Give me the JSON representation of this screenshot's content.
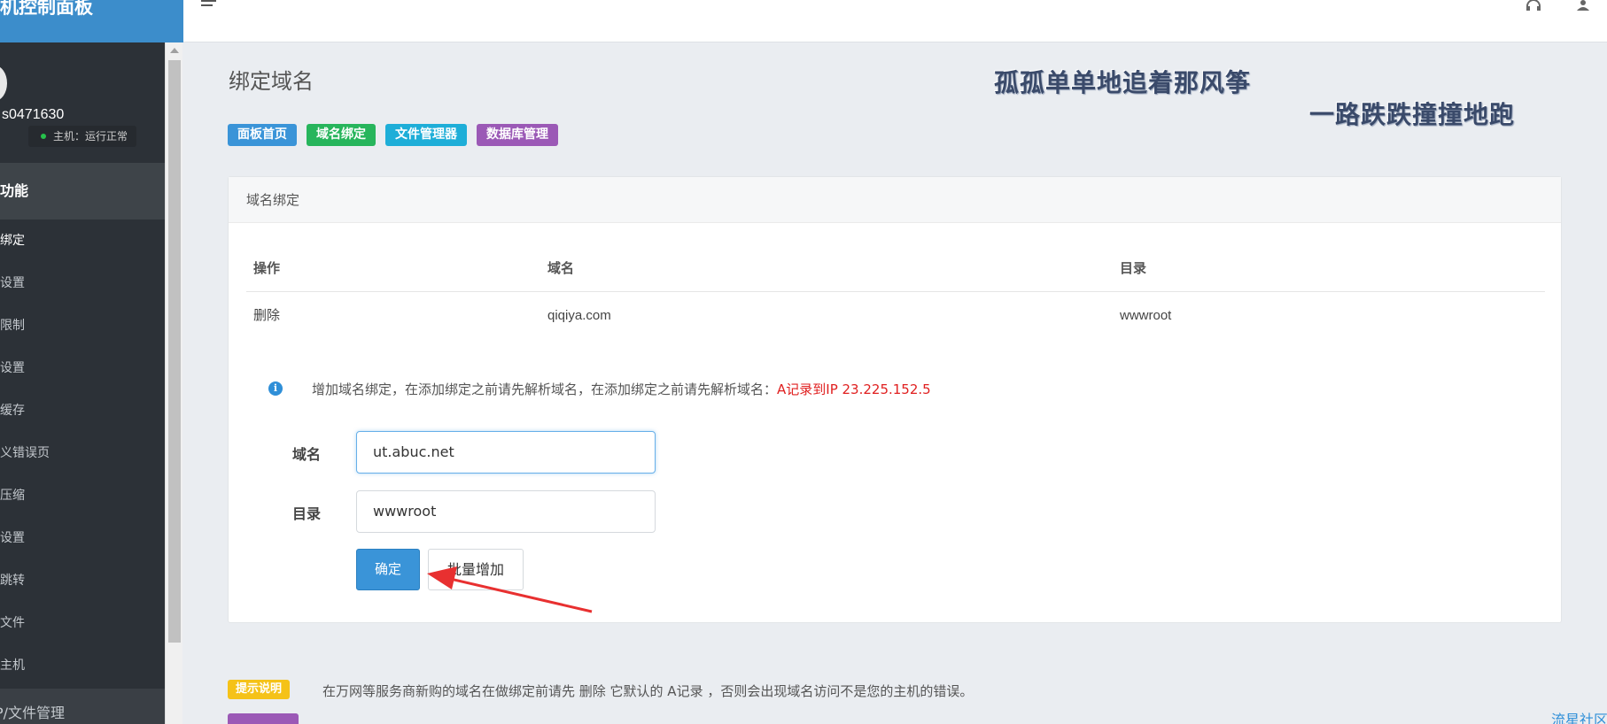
{
  "brand": {
    "title": "机控制面板"
  },
  "user": {
    "name": "s0471630",
    "status": "主机：运行正常"
  },
  "sidebar": {
    "section_title": "本功能",
    "items": [
      {
        "label": "绑定"
      },
      {
        "label": "设置"
      },
      {
        "label": "限制"
      },
      {
        "label": "设置"
      },
      {
        "label": "缓存"
      },
      {
        "label": "义错误页"
      },
      {
        "label": "压缩"
      },
      {
        "label": "设置"
      },
      {
        "label": "跳转"
      },
      {
        "label": "文件"
      },
      {
        "label": "主机"
      }
    ],
    "section2_title": "P/文件管理"
  },
  "page": {
    "title": "绑定域名"
  },
  "slogan": {
    "line1": "孤孤单单地追着那风筝",
    "line2": "一路跌跌撞撞地跑"
  },
  "quick_links": [
    {
      "label": "面板首页",
      "color": "#3a94d8"
    },
    {
      "label": "域名绑定",
      "color": "#27b55c"
    },
    {
      "label": "文件管理器",
      "color": "#1eaed8"
    },
    {
      "label": "数据库管理",
      "color": "#9b59b6"
    }
  ],
  "panel": {
    "title": "域名绑定"
  },
  "table": {
    "headers": [
      "操作",
      "域名",
      "目录"
    ],
    "rows": [
      {
        "action": "删除",
        "domain": "qiqiya.com",
        "dir": "wwwroot"
      }
    ]
  },
  "notice": {
    "text": "增加域名绑定，在添加绑定之前请先解析域名，在添加绑定之前请先解析域名：",
    "highlight": "A记录到IP 23.225.152.5"
  },
  "form": {
    "domain_label": "域名",
    "domain_value": "ut.abuc.net",
    "dir_label": "目录",
    "dir_value": "wwwroot",
    "confirm_label": "确定",
    "batch_label": "批量增加"
  },
  "tips": {
    "tag1": "提示说明",
    "tag1_color": "#f5c218",
    "text1": "在万网等服务商新购的域名在做绑定前请先 删除 它默认的 A记录 ，否则会出现域名访问不是您的主机的错误。",
    "tag2_color": "#9b59b6"
  },
  "community": "流星社区"
}
